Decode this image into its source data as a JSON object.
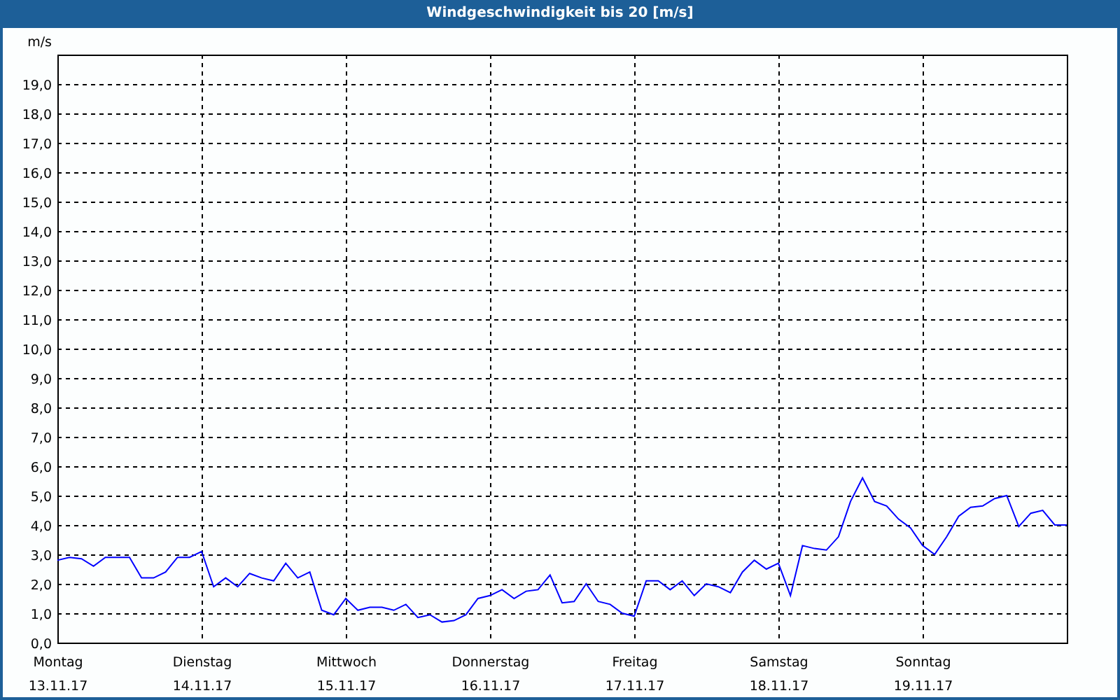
{
  "chart_data": {
    "type": "line",
    "grid": true,
    "title": "Windgeschwindigkeit bis 20 [m/s]",
    "ylabel": "m/s",
    "ylim": [
      0,
      20
    ],
    "yticks": [
      {
        "value": 0,
        "label": "0,0"
      },
      {
        "value": 1,
        "label": "1,0"
      },
      {
        "value": 2,
        "label": "2,0"
      },
      {
        "value": 3,
        "label": "3,0"
      },
      {
        "value": 4,
        "label": "4,0"
      },
      {
        "value": 5,
        "label": "5,0"
      },
      {
        "value": 6,
        "label": "6,0"
      },
      {
        "value": 7,
        "label": "7,0"
      },
      {
        "value": 8,
        "label": "8,0"
      },
      {
        "value": 9,
        "label": "9,0"
      },
      {
        "value": 10,
        "label": "10,0"
      },
      {
        "value": 11,
        "label": "11,0"
      },
      {
        "value": 12,
        "label": "12,0"
      },
      {
        "value": 13,
        "label": "13,0"
      },
      {
        "value": 14,
        "label": "14,0"
      },
      {
        "value": 15,
        "label": "15,0"
      },
      {
        "value": 16,
        "label": "16,0"
      },
      {
        "value": 17,
        "label": "17,0"
      },
      {
        "value": 18,
        "label": "18,0"
      },
      {
        "value": 19,
        "label": "19,0"
      }
    ],
    "categories": [
      "Montag 13.11.17",
      null,
      null,
      null,
      null,
      null,
      null,
      null,
      null,
      null,
      null,
      null,
      "Dienstag 14.11.17",
      null,
      null,
      null,
      null,
      null,
      null,
      null,
      null,
      null,
      null,
      null,
      "Mittwoch 15.11.17",
      null,
      null,
      null,
      null,
      null,
      null,
      null,
      null,
      null,
      null,
      null,
      "Donnerstag 16.11.17",
      null,
      null,
      null,
      null,
      null,
      null,
      null,
      null,
      null,
      null,
      null,
      "Freitag 17.11.17",
      null,
      null,
      null,
      null,
      null,
      null,
      null,
      null,
      null,
      null,
      null,
      "Samstag 18.11.17",
      null,
      null,
      null,
      null,
      null,
      null,
      null,
      null,
      null,
      null,
      null,
      "Sonntag 19.11.17",
      null,
      null,
      null,
      null,
      null,
      null,
      null,
      null,
      null,
      null,
      null,
      null
    ],
    "series": [
      {
        "color": "#0000ff",
        "values": [
          2.8,
          2.9,
          2.85,
          2.6,
          2.9,
          2.9,
          2.9,
          2.2,
          2.2,
          2.4,
          2.9,
          2.9,
          3.1,
          1.9,
          2.2,
          1.9,
          2.35,
          2.2,
          2.1,
          2.7,
          2.2,
          2.4,
          1.1,
          0.95,
          1.5,
          1.1,
          1.2,
          1.2,
          1.1,
          1.3,
          0.85,
          0.95,
          0.7,
          0.75,
          0.95,
          1.5,
          1.6,
          1.8,
          1.5,
          1.75,
          1.8,
          2.3,
          1.35,
          1.4,
          2.0,
          1.4,
          1.3,
          1.0,
          0.9,
          2.1,
          2.1,
          1.8,
          2.1,
          1.6,
          2.0,
          1.9,
          1.7,
          2.4,
          2.8,
          2.5,
          2.7,
          1.6,
          3.3,
          3.2,
          3.15,
          3.6,
          4.8,
          5.6,
          4.8,
          4.65,
          4.2,
          3.9,
          3.3,
          3.0,
          3.6,
          4.3,
          4.6,
          4.65,
          4.9,
          5.0,
          3.95,
          4.4,
          4.5,
          4.0,
          4.0
        ]
      }
    ]
  }
}
